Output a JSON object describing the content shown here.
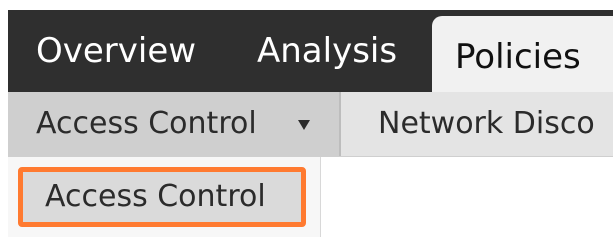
{
  "top_nav": {
    "tabs": [
      {
        "label": "Overview",
        "active": false
      },
      {
        "label": "Analysis",
        "active": false
      },
      {
        "label": "Policies",
        "active": true
      }
    ]
  },
  "sub_nav": {
    "items": [
      {
        "label": "Access Control",
        "has_dropdown": true
      },
      {
        "label": "Network Disco"
      }
    ]
  },
  "dropdown": {
    "items": [
      {
        "label": "Access Control",
        "highlighted": true
      }
    ]
  },
  "colors": {
    "top_nav_bg": "#2f2f2f",
    "active_tab_bg": "#f1f1f1",
    "sub_nav_bg": "#e4e4e4",
    "highlight_border": "#ff7a30"
  }
}
